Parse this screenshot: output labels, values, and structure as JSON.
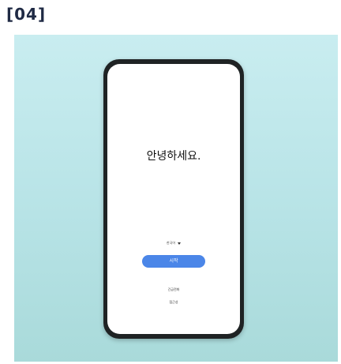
{
  "step_label": "[04]",
  "phone": {
    "greeting": "안녕하세요.",
    "language_value": "한국어",
    "start_button_label": "시작",
    "emergency_call_label": "긴급전화",
    "accessibility_label": "접근성"
  },
  "colors": {
    "panel_top": "#c9edf0",
    "panel_bottom": "#a9dada",
    "start_button": "#4b86e8",
    "phone_frame": "#1f2324"
  }
}
